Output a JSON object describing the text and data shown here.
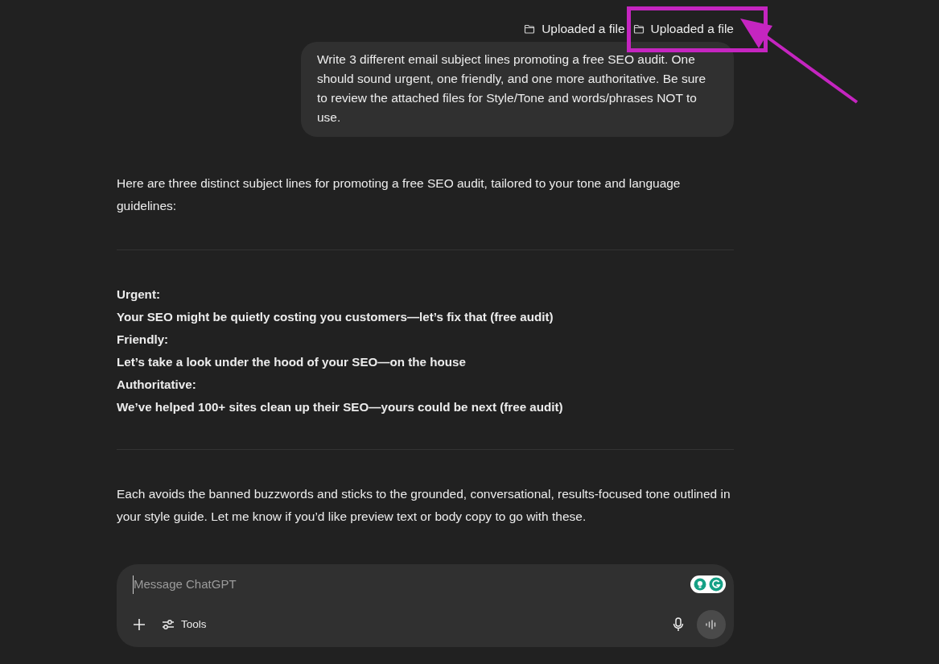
{
  "attachments": [
    {
      "label": "Uploaded a file",
      "highlighted": false
    },
    {
      "label": "Uploaded a file",
      "highlighted": true
    }
  ],
  "user_message": "Write 3 different email subject lines promoting a free SEO audit. One should sound urgent, one friendly, and one more authoritative. Be sure to review the attached files for Style/Tone and words/phrases NOT to use.",
  "response": {
    "intro": "Here are three distinct subject lines for promoting a free SEO audit, tailored to your tone and language guidelines:",
    "subject_lines": [
      {
        "label": "Urgent:",
        "line": "Your SEO might be quietly costing you customers—let’s fix that (free audit)"
      },
      {
        "label": "Friendly:",
        "line": "Let’s take a look under the hood of your SEO—on the house"
      },
      {
        "label": "Authoritative:",
        "line": "We’ve helped 100+ sites clean up their SEO—yours could be next (free audit)"
      }
    ],
    "closing": "Each avoids the banned buzzwords and sticks to the grounded, conversational, results-focused tone outlined in your style guide. Let me know if you’d like preview text or body copy to go with these."
  },
  "composer": {
    "placeholder": "Message ChatGPT",
    "tools_label": "Tools"
  }
}
